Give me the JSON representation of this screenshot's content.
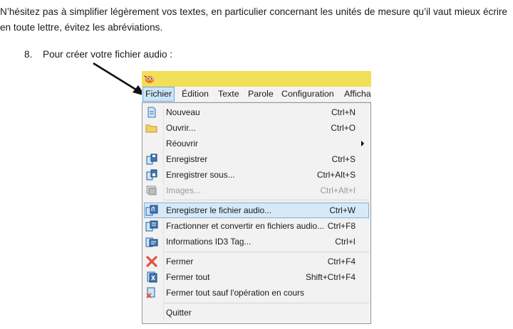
{
  "document": {
    "paragraph": "N’hésitez pas à simplifier légèrement vos textes, en particulier concernant les unités de mesure qu’il vaut mieux écrire en toute lettre, évitez les abréviations.",
    "step_number": "8.",
    "step_text": "Pour créer votre fichier audio :"
  },
  "menubar": {
    "items": [
      "Fichier",
      "Édition",
      "Texte",
      "Parole",
      "Configuration",
      "Afficha"
    ]
  },
  "menu": {
    "items": [
      {
        "label": "Nouveau",
        "shortcut": "Ctrl+N",
        "icon": "new-document-icon"
      },
      {
        "label": "Ouvrir...",
        "shortcut": "Ctrl+O",
        "icon": "folder-open-icon"
      },
      {
        "label": "Réouvrir",
        "shortcut": "",
        "icon": ""
      },
      {
        "label": "Enregistrer",
        "shortcut": "Ctrl+S",
        "icon": "save-icon"
      },
      {
        "label": "Enregistrer sous...",
        "shortcut": "Ctrl+Alt+S",
        "icon": "save-as-icon"
      },
      {
        "label": "Images...",
        "shortcut": "Ctrl+Alt+I",
        "icon": "images-icon"
      },
      {
        "label": "Enregistrer le fichier audio...",
        "shortcut": "Ctrl+W",
        "icon": "save-audio-icon"
      },
      {
        "label": "Fractionner et convertir en fichiers audio...",
        "shortcut": "Ctrl+F8",
        "icon": "split-audio-icon"
      },
      {
        "label": "Informations ID3 Tag...",
        "shortcut": "Ctrl+I",
        "icon": "id3-tag-icon"
      },
      {
        "label": "Fermer",
        "shortcut": "Ctrl+F4",
        "icon": "close-x-icon"
      },
      {
        "label": "Fermer tout",
        "shortcut": "Shift+Ctrl+F4",
        "icon": "close-all-icon"
      },
      {
        "label": "Fermer tout sauf l'opération en cours",
        "shortcut": "",
        "icon": "close-others-icon"
      },
      {
        "label": "Quitter",
        "shortcut": "",
        "icon": ""
      }
    ]
  },
  "colors": {
    "titlebar": "#f1df58",
    "highlight": "#d7e8f7",
    "disabled_text": "#9a9a9a",
    "close_icon": "#e0543a"
  }
}
